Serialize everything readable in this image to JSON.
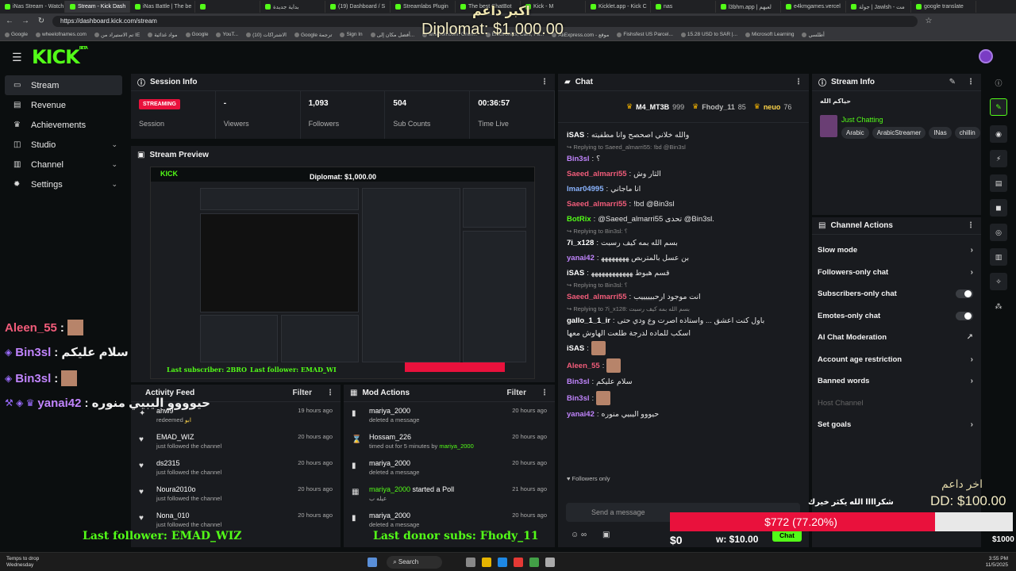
{
  "browser": {
    "tabs": [
      "iNas Stream - Watch",
      "Stream - Kick Dash",
      "iNas Battle | The be",
      "",
      "بداية جديدة",
      "(19) Dashboard / S",
      "Streamlabs Plugin",
      "The best ChatBot",
      "Kick - M",
      "Kicklet.app - Kick C",
      "nas",
      "l3bhm.app | لعبهم",
      "e4kmgames.vercel",
      "جولة | Jawlsh - مت",
      "google translate"
    ],
    "active_tab": 1,
    "url": "https://dashboard.kick.com/stream",
    "bookmarks": [
      "Google",
      "wheelofnames.com",
      "تم الاستيراد من IE",
      "مواد غذائية",
      "Google",
      "YouT...",
      "(10) الاشتراكات",
      "Google ترجمة",
      "Sign In",
      "أفضل مكان إلى...",
      "amazon.com: Onlin...",
      "Electronics, Cars, Fa...",
      "AliExpress.com - موقع",
      "Fishsfest US Parcel...",
      "15.28 USD to SAR |...",
      "Microsoft Learning",
      "أطلسي"
    ]
  },
  "header": {
    "logo": "KICK",
    "logo_sup": "BETA"
  },
  "sidebar": {
    "items": [
      {
        "label": "Stream",
        "icon": "monitor-icon",
        "active": true,
        "chevron": false
      },
      {
        "label": "Revenue",
        "icon": "revenue-icon",
        "chevron": false
      },
      {
        "label": "Achievements",
        "icon": "trophy-icon",
        "chevron": false
      },
      {
        "label": "Studio",
        "icon": "studio-icon",
        "chevron": true
      },
      {
        "label": "Channel",
        "icon": "channel-icon",
        "chevron": true
      },
      {
        "label": "Settings",
        "icon": "gear-icon",
        "chevron": true
      }
    ]
  },
  "session": {
    "title": "Session Info",
    "badge": "STREAMING",
    "stats": [
      {
        "value": "",
        "label": "Session"
      },
      {
        "value": "-",
        "label": "Viewers"
      },
      {
        "value": "1,093",
        "label": "Followers"
      },
      {
        "value": "504",
        "label": "Sub Counts"
      },
      {
        "value": "00:36:57",
        "label": "Time Live"
      }
    ]
  },
  "preview": {
    "title": "Stream Preview"
  },
  "activity": {
    "title": "Activity Feed",
    "filter": "Filter",
    "items": [
      {
        "name": "ahw9",
        "desc": "redeemed",
        "extra": "ابو",
        "time": "19 hours ago",
        "icon": "redeem-icon"
      },
      {
        "name": "EMAD_WIZ",
        "desc": "just followed the channel",
        "time": "20 hours ago",
        "icon": "heart-icon"
      },
      {
        "name": "ds2315",
        "desc": "just followed the channel",
        "time": "20 hours ago",
        "icon": "heart-icon"
      },
      {
        "name": "Noura2010o",
        "desc": "just followed the channel",
        "time": "20 hours ago",
        "icon": "heart-icon"
      },
      {
        "name": "Nona_010",
        "desc": "just followed the channel",
        "time": "20 hours ago",
        "icon": "heart-icon"
      }
    ]
  },
  "mod": {
    "title": "Mod Actions",
    "filter": "Filter",
    "items": [
      {
        "name": "mariya_2000",
        "desc": "deleted a message",
        "time": "20 hours ago",
        "icon": "trash-icon"
      },
      {
        "name": "Hossam_226",
        "desc": "timed out for 5 minutes by",
        "by": "mariya_2000",
        "time": "20 hours ago",
        "icon": "hourglass-icon"
      },
      {
        "name": "mariya_2000",
        "desc": "deleted a message",
        "time": "20 hours ago",
        "icon": "trash-icon"
      },
      {
        "name": "mariya_2000",
        "inline": "started a Poll",
        "desc": "عيله ب",
        "time": "21 hours ago",
        "icon": "poll-icon"
      },
      {
        "name": "mariya_2000",
        "desc": "deleted a message",
        "time": "20 hours ago",
        "icon": "trash-icon"
      }
    ]
  },
  "chat": {
    "title": "Chat",
    "leaders": [
      {
        "name": "M4_MT3B",
        "count": "999"
      },
      {
        "name": "Fhody_11",
        "count": "85"
      },
      {
        "name": "neuo",
        "count": "76"
      }
    ],
    "lines": [
      {
        "type": "msg",
        "user": "iSAS",
        "color": "#ffffff",
        "text": "والله خلاني اصحصح وانا مطفيته"
      },
      {
        "type": "reply",
        "text": "Replying to Saeed_almarri55: !bd @Bin3sl"
      },
      {
        "type": "msg",
        "user": "Bin3sl",
        "color": "#c084fc",
        "text": "؟"
      },
      {
        "type": "msg",
        "user": "Saeed_almarri55",
        "color": "#f25c7a",
        "text": "الثار وش"
      },
      {
        "type": "msg",
        "user": "lmar04995",
        "color": "#8ab4ff",
        "text": "انا ماجاني"
      },
      {
        "type": "msg",
        "user": "Saeed_almarri55",
        "color": "#f25c7a",
        "text": "!bd @Bin3sl"
      },
      {
        "type": "msg",
        "user": "BotRix",
        "color": "#53fc18",
        "text": "@Saeed_almarri55 تحدى @Bin3sl."
      },
      {
        "type": "reply",
        "text": "Replying to Bin3sl: ؟"
      },
      {
        "type": "msg",
        "user": "7i_x128",
        "color": "#ffffff",
        "text": "بسم الله بمه كيف رسبت"
      },
      {
        "type": "msg",
        "user": "yanai42",
        "color": "#c084fc",
        "text": "بن عسل بالمتربص ﻬﻬﻬﻬﻬﻬﻬﻬ"
      },
      {
        "type": "msg",
        "user": "iSAS",
        "color": "#ffffff",
        "text": "قسم هبوط ﻬﻬﻬﻬﻬﻬﻬﻬﻬﻬﻬﻬ"
      },
      {
        "type": "reply",
        "text": "Replying to Bin3sl: ؟"
      },
      {
        "type": "msg",
        "user": "Saeed_almarri55",
        "color": "#f25c7a",
        "text": "انت موجود ارحبيييييب"
      },
      {
        "type": "reply",
        "text": "Replying to 7i_x128: بسم الله بمه كيف رسبت"
      },
      {
        "type": "msg",
        "user": "gallo_1_1_ir",
        "color": "#ffffff",
        "text": "باول كنت اعشق ... واستاذه اصرت وع ودي حتى"
      },
      {
        "type": "cont",
        "text": "اسكب للماده لدرجة طلعت الهاوش معها"
      },
      {
        "type": "msg",
        "user": "iSAS",
        "color": "#ffffff",
        "text": ""
      },
      {
        "type": "msg",
        "user": "Aleen_55",
        "color": "#f25c7a",
        "text": ""
      },
      {
        "type": "msg",
        "user": "Bin3sl",
        "color": "#c084fc",
        "text": "سلام عليكم"
      },
      {
        "type": "msg",
        "user": "Bin3sl",
        "color": "#c084fc",
        "text": ""
      },
      {
        "type": "msg",
        "user": "yanai42",
        "color": "#c084fc",
        "text": "حيووو اليبيي منوره"
      }
    ],
    "followers_only": "Followers only",
    "placeholder": "Send a message",
    "send": "Chat"
  },
  "info": {
    "title": "Stream Info",
    "stream_title": "حياكم الله",
    "category": "Just Chatting",
    "tags": [
      "Arabic",
      "ArabicStreamer",
      "INas",
      "chillin"
    ]
  },
  "actions": {
    "title": "Channel Actions",
    "items": [
      {
        "label": "Slow mode",
        "ctl": "chevron"
      },
      {
        "label": "Followers-only chat",
        "ctl": "chevron"
      },
      {
        "label": "Subscribers-only chat",
        "ctl": "toggle"
      },
      {
        "label": "Emotes-only chat",
        "ctl": "toggle"
      },
      {
        "label": "AI Chat Moderation",
        "ctl": "external"
      },
      {
        "label": "Account age restriction",
        "ctl": "chevron"
      },
      {
        "label": "Banned words",
        "ctl": "chevron"
      },
      {
        "label": "Host Channel",
        "ctl": "none",
        "disabled": true
      },
      {
        "label": "Set goals",
        "ctl": "chevron"
      }
    ]
  },
  "overlay": {
    "top_label": "اكبر داعم",
    "top_amount": "Diplomat: $1,000.00",
    "chat_users": [
      {
        "name": "Aleen_55",
        "text": ":",
        "color": "#f25c7a"
      },
      {
        "name": "Bin3sl",
        "text": ": سلام عليكم",
        "color": "#c084fc"
      },
      {
        "name": "Bin3sl",
        "text": ":",
        "color": "#c084fc"
      },
      {
        "name": "yanai42",
        "text": ": حيوووو اليبيي منوره",
        "color": "#c084fc"
      }
    ],
    "last_follower": "Last follower: EMAD_WIZ",
    "last_donor": "Last donor subs: Fhody_11",
    "last_donor_label": "اخر داعم",
    "last_donor_amount": "DD: $100.00",
    "goal_text": "$772 (77.20%)",
    "goal_fraction": 0.772,
    "thanks": "شكراااا الله يكثر خيرك",
    "goal_start": "$0",
    "goal_end": "$1000",
    "goal_mid": "w: $10.00",
    "preview_amount": "Diplomat: $1,000.00"
  },
  "taskbar": {
    "weather": "Temps to drop",
    "weather_sub": "Wednesday",
    "search": "Search",
    "time": "3:55 PM",
    "date": "11/5/2025"
  },
  "colors": {
    "accent": "#53fc18",
    "danger": "#e9113c",
    "panel": "#191b1f"
  }
}
